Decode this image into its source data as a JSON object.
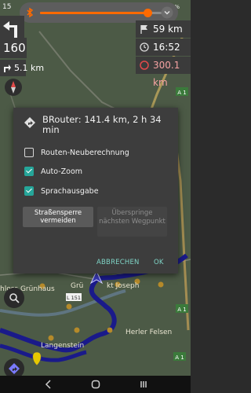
{
  "status": {
    "time": "15",
    "battery": "100%"
  },
  "volume": {
    "level": 0.87
  },
  "hud": {
    "turn_distance": "160 m",
    "next_turn_distance": "5.1 km",
    "remaining_distance": "59 km",
    "arrival_time": "16:52",
    "max_distance": "300.1 km"
  },
  "map_labels": {
    "a1_top": "A 1",
    "a1_bottom": "A 1",
    "a1_bottom2": "A 1",
    "l151": "L 151",
    "place1": "hloss Grünhaus",
    "place2": "Grü",
    "place3": "kt Joseph",
    "place4": "Langenstein",
    "place5": "Herler Felsen"
  },
  "dialog": {
    "title": "BRouter: 141.4 km, 2 h 34 min",
    "options": [
      {
        "label": "Routen-Neuberechnung",
        "checked": false
      },
      {
        "label": "Auto-Zoom",
        "checked": true
      },
      {
        "label": "Sprachausgabe",
        "checked": true
      }
    ],
    "button_roadblock": "Straßensperre vermeiden",
    "button_skip": "Überspringe nächsten Wegpunkt",
    "cancel": "ABBRECHEN",
    "ok": "OK"
  },
  "colors": {
    "accent": "#26a69a",
    "volume": "#ff6a00",
    "route": "#1a1a8a"
  }
}
